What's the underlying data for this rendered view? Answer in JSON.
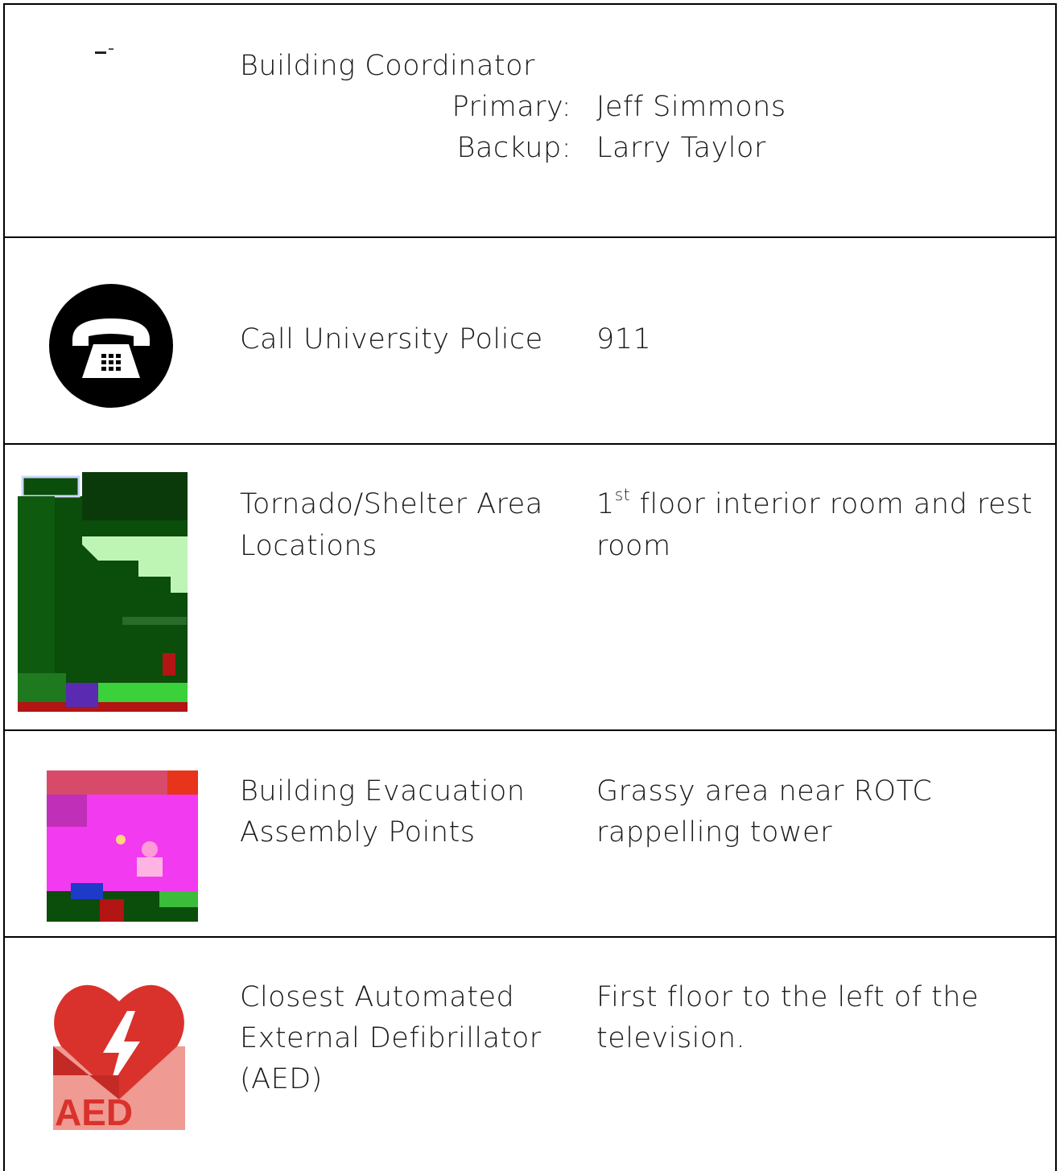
{
  "rows": {
    "coordinator": {
      "label": "Building Coordinator",
      "primary_label": "Primary:",
      "primary_value": "Jeff Simmons",
      "backup_label": "Backup:",
      "backup_value": "Larry Taylor"
    },
    "police": {
      "label": "Call University Police",
      "value": "911",
      "icon": "phone-icon"
    },
    "shelter": {
      "label_line1": "Tornado/Shelter Area",
      "label_line2": "Locations",
      "value_num": "1",
      "value_sup": "st",
      "value_rest": " floor interior room and rest",
      "value_line2": "room",
      "icon": "shelter-map-icon"
    },
    "evacuation": {
      "label_line1": "Building Evacuation",
      "label_line2": "Assembly Points",
      "value_line1": "Grassy area near ROTC",
      "value_line2": "rappelling tower",
      "icon": "assembly-point-icon"
    },
    "aed": {
      "label_line1": "Closest Automated",
      "label_line2": "External Defibrillator",
      "label_line3": "(AED)",
      "value_line1": "First floor to the left of the",
      "value_line2": "television.",
      "icon": "aed-icon",
      "icon_text": "AED"
    }
  },
  "colors": {
    "aed_red": "#d9322c",
    "aed_pink": "#ef9a92",
    "shelter_green": "#0b4d0b",
    "evac_magenta": "#f23af0"
  }
}
